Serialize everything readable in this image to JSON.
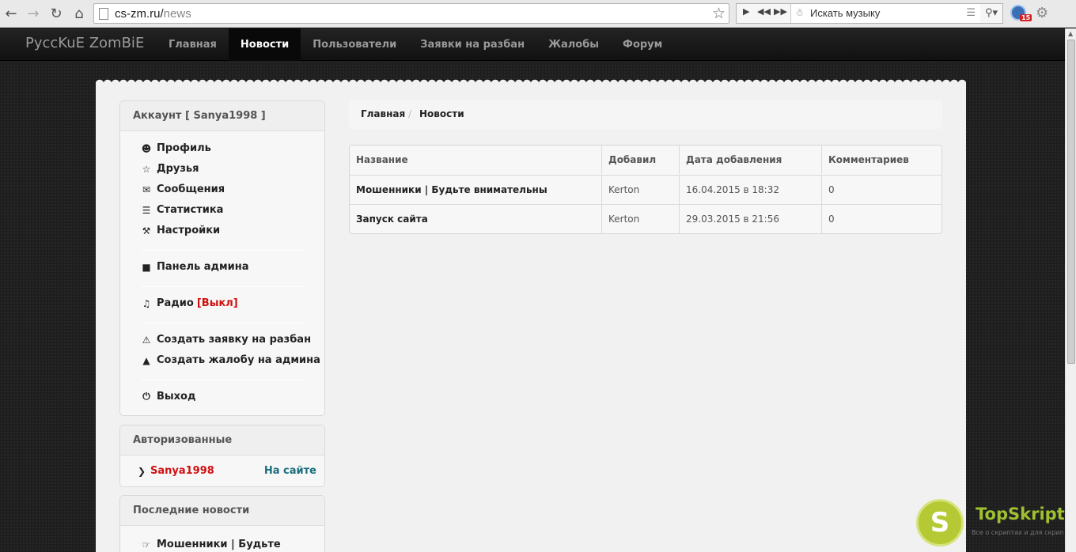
{
  "browser": {
    "url_host": "cs-zm.ru/",
    "url_path": "news",
    "music_placeholder": "Искать музыку",
    "extension_badge": "15"
  },
  "site": {
    "brand": "PyccKuE ZomBiE",
    "menu": [
      {
        "label": "Главная"
      },
      {
        "label": "Новости"
      },
      {
        "label": "Пользователи"
      },
      {
        "label": "Заявки на разбан"
      },
      {
        "label": "Жалобы"
      },
      {
        "label": "Форум"
      }
    ]
  },
  "account": {
    "title": "Аккаунт [ Sanya1998 ]",
    "links": [
      {
        "label": "Профиль",
        "icon": "user-icon"
      },
      {
        "label": "Друзья",
        "icon": "star-icon"
      },
      {
        "label": "Сообщения",
        "icon": "envelope-icon"
      },
      {
        "label": "Статистика",
        "icon": "list-icon"
      },
      {
        "label": "Настройки",
        "icon": "wrench-icon"
      }
    ],
    "admin_panel": "Панель админа",
    "radio": "Радио",
    "radio_status": "[Выкл]",
    "unban_request": "Создать заявку на разбан",
    "complaint": "Создать жалобу на админа",
    "logout": "Выход"
  },
  "authorized": {
    "title": "Авторизованные",
    "user": "Sanya1998",
    "status": "На сайте"
  },
  "latest_news": {
    "title": "Последние новости",
    "first_item": "Мошенники | Будьте"
  },
  "breadcrumb": {
    "home": "Главная",
    "current": "Новости"
  },
  "news_table": {
    "headers": [
      "Название",
      "Добавил",
      "Дата добавления",
      "Комментариев"
    ],
    "rows": [
      {
        "title": "Мошенники | Будьте внимательны",
        "author": "Kerton",
        "date": "16.04.2015 в 18:32",
        "comments": "0"
      },
      {
        "title": "Запуск сайта",
        "author": "Kerton",
        "date": "29.03.2015 в 21:56",
        "comments": "0"
      }
    ]
  },
  "watermark": {
    "logo_letter": "S",
    "brand": "TopSkript",
    "tagline": "Все о скриптах и для скриптов"
  },
  "colors": {
    "accent_red": "#d01010",
    "online_teal": "#1a6e7e",
    "watermark_green": "#b5c934"
  }
}
